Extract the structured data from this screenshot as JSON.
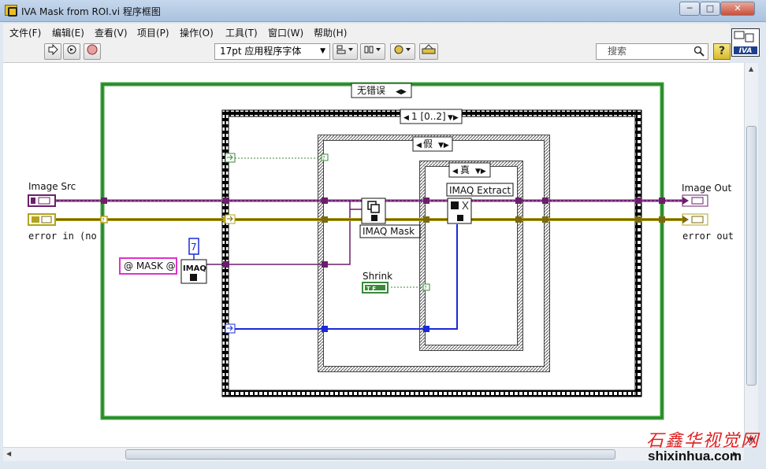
{
  "window": {
    "title": "IVA Mask from ROI.vi 程序框图",
    "min_label": "─",
    "max_label": "□",
    "close_label": "✕"
  },
  "menu": {
    "items": [
      "文件(F)",
      "编辑(E)",
      "查看(V)",
      "项目(P)",
      "操作(O)",
      "工具(T)",
      "窗口(W)",
      "帮助(H)"
    ]
  },
  "toolbar": {
    "font": "17pt 应用程序字体",
    "search_placeholder": "搜索",
    "help": "?"
  },
  "logo": {
    "text": "IVA"
  },
  "diagram": {
    "outer_case_selector": "无错误",
    "sequence_selector": "1 [0..2]",
    "false_case_selector": "假",
    "true_case_selector": "真",
    "image_src_label": "Image Src",
    "error_in_label": "error in (no",
    "image_out_label": "Image Out",
    "error_out_label": "error out",
    "mask_constant": "@ MASK @",
    "numeric_constant": "7",
    "imaq_create_label": "IMAQ",
    "imaq_mask_label": "IMAQ Mask",
    "imaq_extract_label": "IMAQ Extract",
    "shrink_label": "Shrink",
    "shrink_constant": "T F",
    "colors": {
      "image_wire": "#6b1f6b",
      "error_wire": "#b3a31a",
      "ref_wire": "#1a2bd8",
      "bool_wire": "#3a8a3a",
      "case_border": "#3aa03a"
    }
  },
  "watermark": {
    "cn": "石鑫华视觉网",
    "url": "shixinhua.com"
  }
}
